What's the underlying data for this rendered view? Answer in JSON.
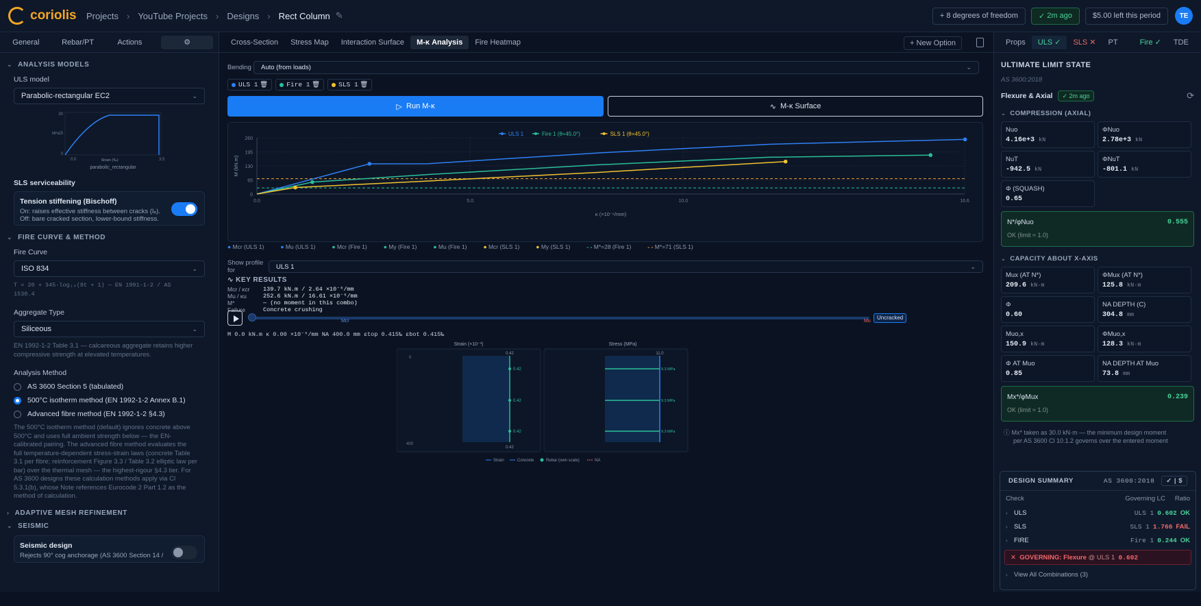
{
  "brand": {
    "name": "coriolis"
  },
  "breadcrumb": [
    "Projects",
    "YouTube Projects",
    "Designs",
    "Rect Column"
  ],
  "top": {
    "dof": "8 degrees of freedom",
    "saved": "2m ago",
    "credit": "$5.00 left this period",
    "avatar": "TE"
  },
  "left": {
    "tabs": [
      "General",
      "Rebar/PT",
      "Actions"
    ],
    "analysis_models": "ANALYSIS MODELS",
    "uls_model_label": "ULS model",
    "uls_model_value": "Parabolic-rectangular EC2",
    "mini_chart": {
      "y_ticks": [
        "30",
        "15",
        "0"
      ],
      "x_ticks": [
        "0.0",
        "3.5"
      ],
      "ylabel": "MPa",
      "xlabel": "Strain (‰)",
      "caption": "parabolic_rectangular"
    },
    "sls_label": "SLS serviceability",
    "tension_title": "Tension stiffening (Bischoff)",
    "tension_line1": "On: raises effective stiffness between cracks (Iₑ).",
    "tension_line2": "Off: bare cracked section, lower-bound stiffness.",
    "fire_curve_head": "FIRE CURVE & METHOD",
    "fire_curve_label": "Fire Curve",
    "fire_curve_value": "ISO 834",
    "fire_formula_1": "T = 20 + 345·log₁₀(8t + 1) — EN 1991-1-2 / AS",
    "fire_formula_2": "1530.4",
    "aggregate_label": "Aggregate Type",
    "aggregate_value": "Siliceous",
    "aggregate_note_1": "EN 1992-1-2 Table 3.1 — calcareous aggregate retains higher",
    "aggregate_note_2": "compressive strength at elevated temperatures.",
    "method_label": "Analysis Method",
    "methods": [
      "AS 3600 Section 5 (tabulated)",
      "500°C isotherm method (EN 1992-1-2 Annex B.1)",
      "Advanced fibre method (EN 1992-1-2 §4.3)"
    ],
    "method_desc": [
      "The 500°C isotherm method (default) ignores concrete above",
      "500°C and uses full ambient strength below — the EN-",
      "calibrated pairing. The advanced fibre method evaluates the",
      "full temperature-dependent stress-strain laws (concrete Table",
      "3.1 per fibre; reinforcement Figure 3.3 / Table 3.2 elliptic law per",
      "bar) over the thermal mesh — the highest-rigour §4.3 tier. For",
      "AS 3600 designs these calculation methods apply via Cl",
      "5.3.1(b), whose Note references Eurocode 2 Part 1.2 as the",
      "method of calculation."
    ],
    "mesh_head": "ADAPTIVE MESH REFINEMENT",
    "seismic_head": "SEISMIC",
    "seismic_title": "Seismic design",
    "seismic_line": "Rejects 90° cog anchorage (AS 3600 Section 14 /"
  },
  "mid": {
    "tabs": [
      "Cross-Section",
      "Stress Map",
      "Interaction Surface",
      "M-κ Analysis",
      "Fire Heatmap"
    ],
    "new_option": "New Option",
    "bending_label": "Bending",
    "bending_value": "Auto (from loads)",
    "chips": [
      "ULS 1",
      "Fire 1",
      "SLS 1"
    ],
    "run_label": "Run M-κ",
    "surface_label": "M-κ Surface",
    "legend_bottom": [
      "Mcr (ULS 1)",
      "Mu (ULS 1)",
      "Mcr (Fire 1)",
      "My (Fire 1)",
      "Mu (Fire 1)",
      "Mcr (SLS 1)",
      "My (SLS 1)",
      "M*=28 (Fire 1)",
      "M*=71 (SLS 1)"
    ],
    "profile_label": "Show profile for",
    "profile_value": "ULS 1",
    "key_results": "KEY RESULTS",
    "kr": [
      {
        "k": "Mcr / κcr",
        "v": "139.7 kN.m / 2.64 ×10⁻⁶/mm"
      },
      {
        "k": "Mu / κu",
        "v": "252.6 kN.m / 16.61 ×10⁻⁶/mm"
      },
      {
        "k": "M*",
        "v": "— (no moment in this combo)"
      },
      {
        "k": "Failure",
        "v": "Concrete crushing"
      }
    ],
    "slider_marks": [
      "Mcr",
      "Mu"
    ],
    "uncracked": "Uncracked",
    "stat": "M 0.0 kN.m   κ 0.00 ×10⁻⁶/mm   NA 400.0 mm   εtop 0.415‰   εbot 0.415‰",
    "strain_title": "Strain (×10⁻³)",
    "stress_title": "Stress (MPa)",
    "strain_top": "0.42",
    "strain_bot": "0.42",
    "strain_bars": [
      "0.42",
      "0.42",
      "0.42"
    ],
    "stress_top": "11.0",
    "stress_bars": [
      "9.3 MPa",
      "9.3 MPa",
      "9.3 MPa"
    ],
    "depth_ticks": [
      "0",
      "400"
    ],
    "panel_legend": [
      "Strain",
      "Concrete",
      "Rebar (own scale)",
      "NA"
    ]
  },
  "chart_data": {
    "type": "line",
    "xlabel": "κ (×10⁻⁶/mm)",
    "ylabel": "M (kN.m)",
    "xlim": [
      0,
      16.6
    ],
    "ylim": [
      0,
      260
    ],
    "x_ticks": [
      0.0,
      5.0,
      10.0,
      16.6
    ],
    "y_ticks": [
      0,
      65,
      130,
      195,
      260
    ],
    "legend": "top-center",
    "series": [
      {
        "name": "ULS 1",
        "color": "#2f80f5",
        "x": [
          0,
          2.64,
          2.64,
          4.0,
          8.0,
          12.0,
          16.61
        ],
        "y": [
          0,
          139.7,
          139.7,
          140,
          190,
          230,
          252.6
        ]
      },
      {
        "name": "Fire 1 (θ=45.0°)",
        "color": "#2bbf9a",
        "x": [
          0,
          1.3,
          4.0,
          8.0,
          12.0,
          15.8
        ],
        "y": [
          0,
          55,
          90,
          135,
          170,
          180
        ]
      },
      {
        "name": "SLS 1 (θ=45.0°)",
        "color": "#f2c230",
        "x": [
          0,
          0.9,
          4.0,
          8.0,
          12.4
        ],
        "y": [
          0,
          30,
          60,
          100,
          150
        ]
      }
    ],
    "ref_lines": [
      {
        "name": "M*=28 (Fire 1)",
        "y": 28,
        "color": "#2bbf9a"
      },
      {
        "name": "M*=71 (SLS 1)",
        "y": 71,
        "color": "#f2a030"
      }
    ]
  },
  "right": {
    "tabs": [
      "Props",
      "ULS",
      "SLS",
      "PT",
      "Fire",
      "TDE"
    ],
    "title": "ULTIMATE LIMIT STATE",
    "code": "AS 3600:2018",
    "flex_label": "Flexure & Axial",
    "flex_badge": "2m ago",
    "comp_head": "COMPRESSION (AXIAL)",
    "comp_cells": [
      {
        "t": "Nuo",
        "v": "4.16e+3",
        "u": "kN"
      },
      {
        "t": "ΦNuo",
        "v": "2.78e+3",
        "u": "kN"
      },
      {
        "t": "NuT",
        "v": "-942.5",
        "u": "kN"
      },
      {
        "t": "ΦNuT",
        "v": "-801.1",
        "u": "kN"
      },
      {
        "t": "Φ (SQUASH)",
        "v": "0.65",
        "u": ""
      }
    ],
    "ratio1_label": "N*/φNuo",
    "ratio1_value": "0.555",
    "ratio1_ok": "OK (limit ≈ 1.0)",
    "cap_head": "CAPACITY ABOUT X-AXIS",
    "cap_cells": [
      {
        "t": "Mux (AT N*)",
        "v": "209.6",
        "u": "kN·m"
      },
      {
        "t": "ΦMux (AT N*)",
        "v": "125.8",
        "u": "kN·m"
      },
      {
        "t": "Φ",
        "v": "0.60",
        "u": ""
      },
      {
        "t": "NA DEPTH (C)",
        "v": "304.8",
        "u": "mm"
      },
      {
        "t": "Muo,x",
        "v": "150.9",
        "u": "kN·m"
      },
      {
        "t": "ΦMuo,x",
        "v": "128.3",
        "u": "kN·m"
      },
      {
        "t": "Φ AT Muo",
        "v": "0.85",
        "u": ""
      },
      {
        "t": "NA DEPTH AT Muo",
        "v": "73.8",
        "u": "mm"
      }
    ],
    "ratio2_label": "Mx*/φMux",
    "ratio2_value": "0.239",
    "ratio2_ok": "OK (limit ≈ 1.0)",
    "info_1": "Mx* taken as 30.0 kN·m — the minimum design moment",
    "info_2": "per AS 3600 Cl 10.1.2 governs over the entered moment",
    "summary_title": "DESIGN SUMMARY",
    "summary_code": "AS 3600:2018",
    "summary_cols": [
      "Check",
      "Governing LC",
      "Ratio"
    ],
    "summary_rows": [
      {
        "name": "ULS",
        "lc": "ULS 1",
        "ratio": "0.602",
        "status": "OK"
      },
      {
        "name": "SLS",
        "lc": "SLS 1",
        "ratio": "1.766",
        "status": "FAIL"
      },
      {
        "name": "FIRE",
        "lc": "Fire 1",
        "ratio": "0.244",
        "status": "OK"
      }
    ],
    "governing": "GOVERNING: Flexure",
    "governing_lc": "@ ULS 1",
    "governing_ratio": "0.602",
    "view_all": "View All Combinations (3)"
  }
}
